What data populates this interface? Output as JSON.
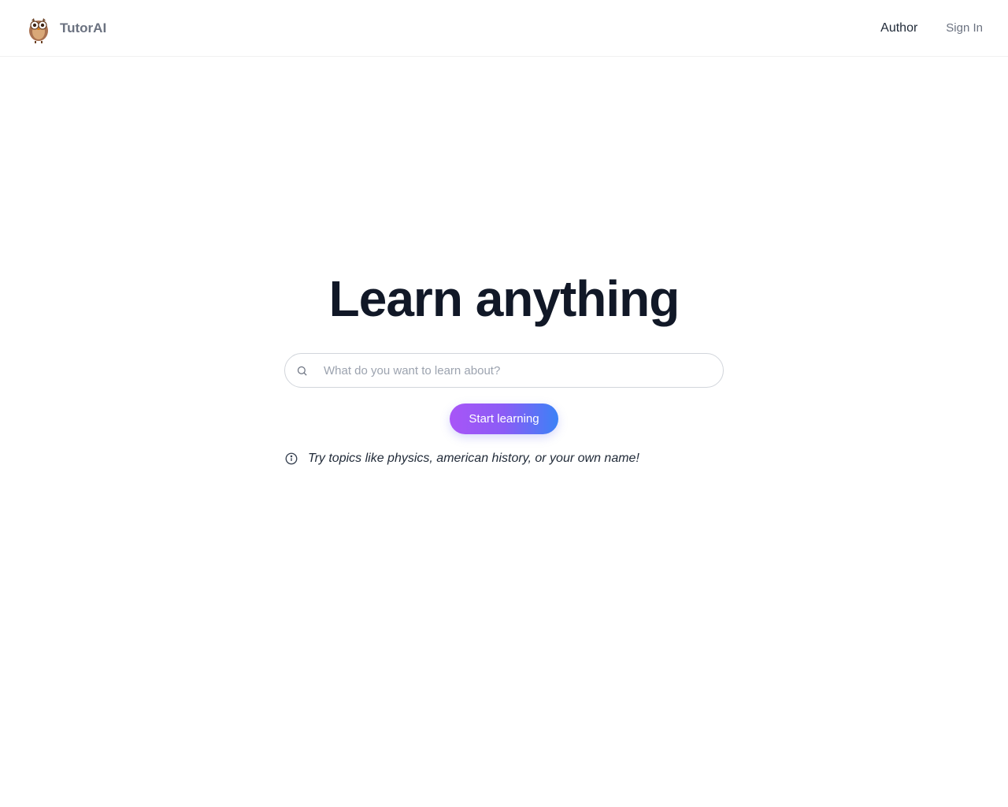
{
  "header": {
    "brand_name": "TutorAI",
    "nav": {
      "author_label": "Author",
      "signin_label": "Sign In"
    }
  },
  "hero": {
    "title": "Learn anything",
    "search_placeholder": "What do you want to learn about?",
    "cta_label": "Start learning",
    "hint_text": "Try topics like physics, american history, or your own name!"
  },
  "icons": {
    "owl": "owl-logo-icon",
    "search": "search-icon",
    "info": "info-icon"
  }
}
